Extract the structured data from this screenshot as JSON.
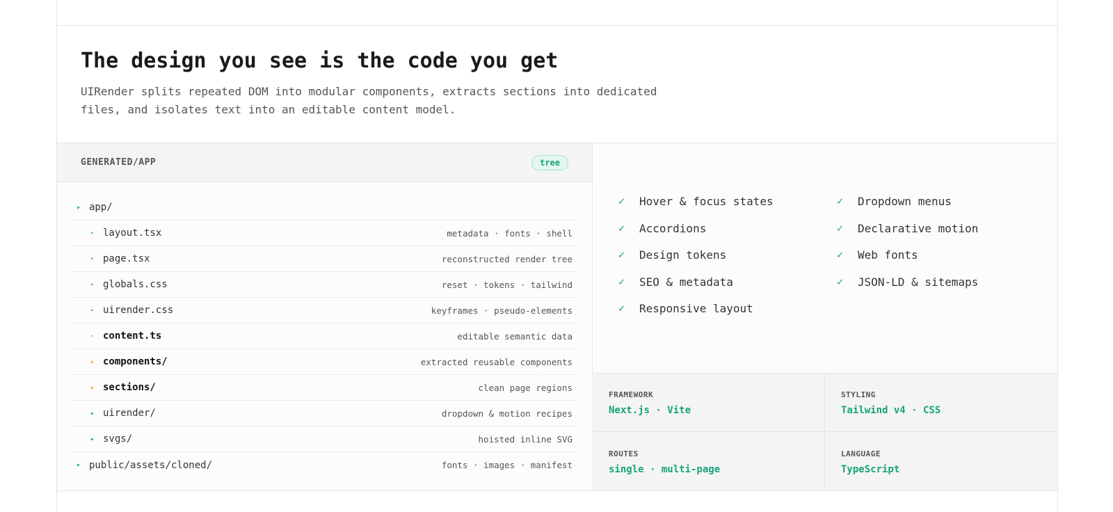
{
  "hero": {
    "title": "The design you see is the code you get",
    "description": "UIRender splits repeated DOM into modular components, extracts sections into dedicated files, and isolates text into an editable content model."
  },
  "tree": {
    "title": "GENERATED/APP",
    "badge": "tree",
    "rows": [
      {
        "name": "app/",
        "note": "",
        "depth": 0,
        "marker": "triangle",
        "color": "#16a37a",
        "bold": false
      },
      {
        "name": "layout.tsx",
        "note": "metadata · fonts · shell",
        "depth": 1,
        "marker": "dot",
        "color": "#16a37a",
        "bold": false
      },
      {
        "name": "page.tsx",
        "note": "reconstructed render tree",
        "depth": 1,
        "marker": "dot",
        "color": "#16a37a",
        "bold": false
      },
      {
        "name": "globals.css",
        "note": "reset · tokens · tailwind",
        "depth": 1,
        "marker": "dot",
        "color": "#16a37a",
        "bold": false
      },
      {
        "name": "uirender.css",
        "note": "keyframes · pseudo-elements",
        "depth": 1,
        "marker": "dot",
        "color": "#16a37a",
        "bold": false
      },
      {
        "name": "content.ts",
        "note": "editable semantic data",
        "depth": 1,
        "marker": "dot",
        "color": "#f0a818",
        "bold": true
      },
      {
        "name": "components/",
        "note": "extracted reusable components",
        "depth": 1,
        "marker": "triangle",
        "color": "#f0a818",
        "bold": true
      },
      {
        "name": "sections/",
        "note": "clean page regions",
        "depth": 1,
        "marker": "triangle",
        "color": "#f0a818",
        "bold": true
      },
      {
        "name": "uirender/",
        "note": "dropdown & motion recipes",
        "depth": 1,
        "marker": "triangle",
        "color": "#16a37a",
        "bold": false
      },
      {
        "name": "svgs/",
        "note": "hoisted inline SVG",
        "depth": 1,
        "marker": "triangle",
        "color": "#16a37a",
        "bold": false
      },
      {
        "name": "public/assets/cloned/",
        "note": "fonts · images · manifest",
        "depth": 0,
        "marker": "triangle",
        "color": "#16a37a",
        "bold": false
      }
    ]
  },
  "features": {
    "col1": [
      "Hover & focus states",
      "Accordions",
      "Design tokens",
      "SEO & metadata",
      "Responsive layout"
    ],
    "col2": [
      "Dropdown menus",
      "Declarative motion",
      "Web fonts",
      "JSON-LD & sitemaps"
    ],
    "check_icon": "check-icon"
  },
  "stats": [
    {
      "label": "FRAMEWORK",
      "value": "Next.js · Vite"
    },
    {
      "label": "STYLING",
      "value": "Tailwind v4 · CSS"
    },
    {
      "label": "ROUTES",
      "value": "single · multi-page"
    },
    {
      "label": "LANGUAGE",
      "value": "TypeScript"
    }
  ],
  "colors": {
    "accent": "#16a37a",
    "highlight": "#f0a818"
  }
}
